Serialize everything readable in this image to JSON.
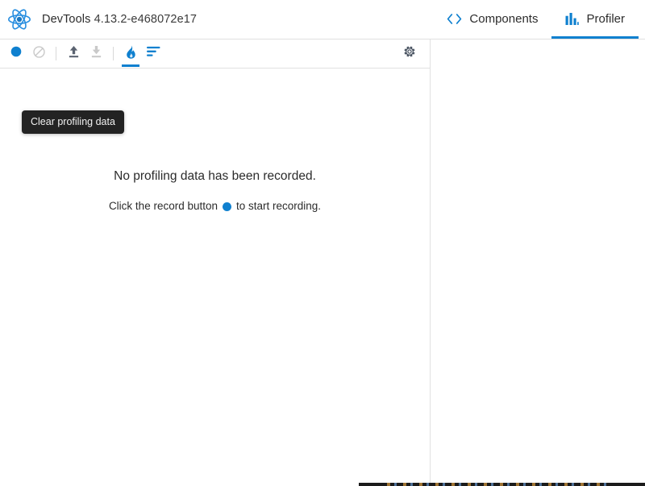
{
  "app": {
    "logo_icon": "react-atom-logo",
    "title": "DevTools",
    "version": "4.13.2-e468072e17",
    "accent_color": "#0f80cf",
    "logo_color": "#1c78c0",
    "border_color": "#e0e0e0"
  },
  "tabs": [
    {
      "id": "components",
      "label": "Components",
      "icon": "code-brackets-icon",
      "active": false
    },
    {
      "id": "profiler",
      "label": "Profiler",
      "icon": "bar-chart-icon",
      "active": true
    }
  ],
  "toolbar": {
    "buttons": [
      {
        "id": "record",
        "icon": "record-dot-icon",
        "state": "enabled",
        "color": "#0f80cf"
      },
      {
        "id": "clear",
        "icon": "no-entry-icon",
        "state": "disabled",
        "color": "#c8c8c8"
      },
      {
        "id": "load",
        "icon": "upload-arrow-icon",
        "state": "enabled",
        "color": "#5a6270"
      },
      {
        "id": "save",
        "icon": "download-arrow-icon",
        "state": "disabled",
        "color": "#c8c8c8"
      },
      {
        "id": "flame-chart",
        "icon": "flame-icon",
        "state": "selected",
        "color": "#0f80cf"
      },
      {
        "id": "ranked-chart",
        "icon": "ranked-bars-icon",
        "state": "enabled",
        "color": "#0f80cf"
      }
    ],
    "settings": {
      "id": "settings",
      "icon": "gear-icon",
      "color": "#4b5563"
    }
  },
  "tooltip": {
    "text": "Clear profiling data",
    "background": "#232323",
    "text_color": "#f2f2f2"
  },
  "empty_state": {
    "title": "No profiling data has been recorded.",
    "hint_before": "Click the record button",
    "hint_after": "to start recording.",
    "record_dot_icon": "record-dot-icon",
    "record_dot_color": "#0f80cf"
  }
}
